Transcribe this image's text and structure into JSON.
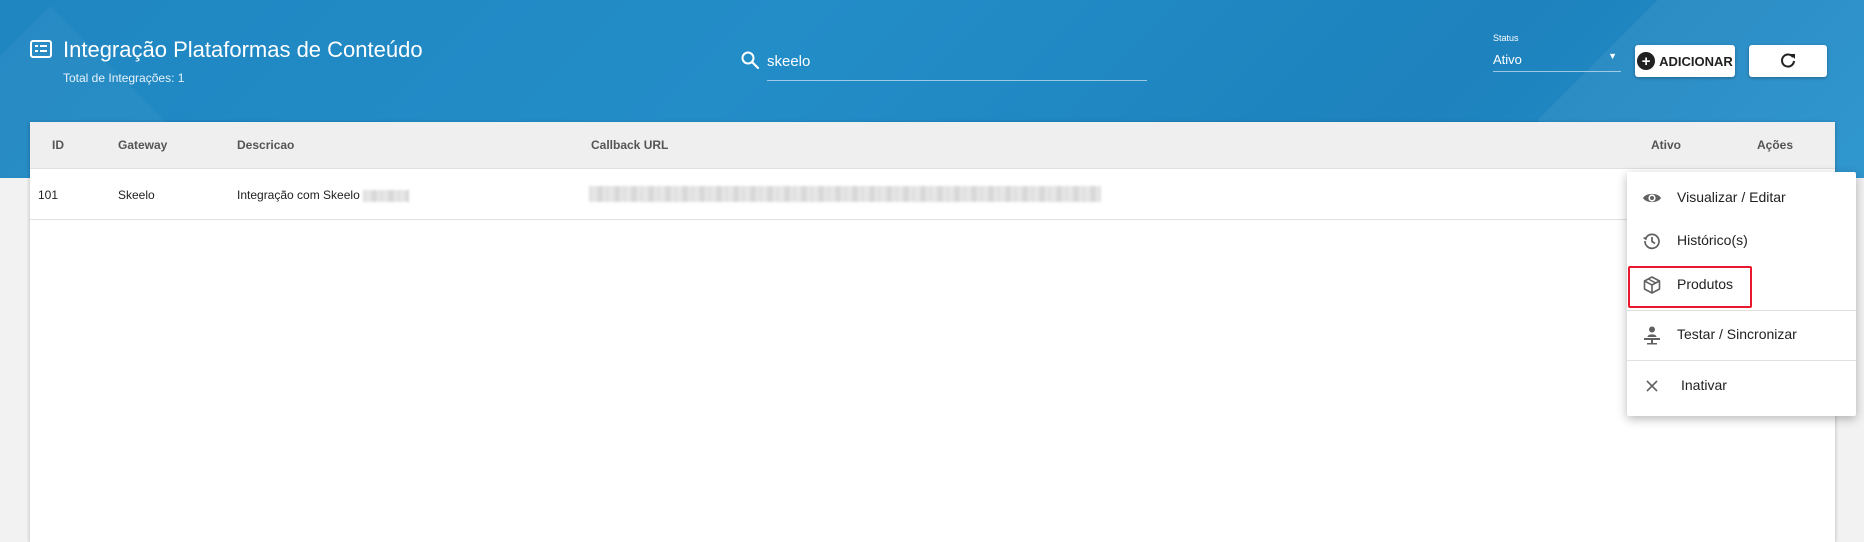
{
  "header": {
    "title": "Integração Plataformas de Conteúdo",
    "subtitle": "Total de Integrações: 1",
    "title_icon": "list-alt-icon"
  },
  "search": {
    "value": "skeelo",
    "icon": "search-icon"
  },
  "status_filter": {
    "label": "Status",
    "value": "Ativo"
  },
  "toolbar": {
    "add_label": "ADICIONAR",
    "refresh_icon": "refresh-icon"
  },
  "table": {
    "columns": [
      "ID",
      "Gateway",
      "Descricao",
      "Callback URL",
      "Ativo",
      "Ações"
    ],
    "rows": [
      {
        "id": "101",
        "gateway": "Skeelo",
        "descricao": "Integração com Skeelo"
      }
    ]
  },
  "actions_menu": {
    "items": [
      {
        "label": "Visualizar / Editar",
        "icon": "eye-icon"
      },
      {
        "label": "Histórico(s)",
        "icon": "history-icon"
      },
      {
        "label": "Produtos",
        "icon": "package-icon"
      },
      {
        "label": "Testar / Sincronizar",
        "icon": "sync-person-icon"
      },
      {
        "label": "Inativar",
        "icon": "close-icon"
      }
    ]
  },
  "colors": {
    "header_blue": "#2189c4",
    "highlight_red": "#e8192c"
  }
}
